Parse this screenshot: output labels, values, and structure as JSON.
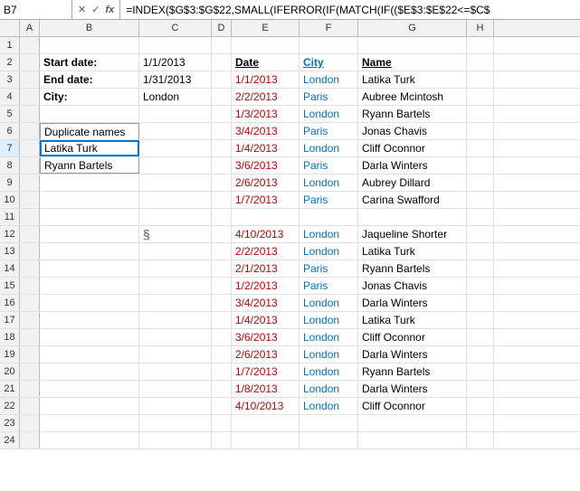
{
  "formula_bar": {
    "cell_ref": "B7",
    "formula": "=INDEX($G$3:$G$22,SMALL(IFERROR(IF(MATCH(IF(($E$3:$E$22<=$C$"
  },
  "columns": [
    "",
    "A",
    "B",
    "C",
    "D",
    "E",
    "F",
    "G",
    "H"
  ],
  "rows": [
    {
      "num": "1",
      "b": "",
      "c": "",
      "d": "",
      "e": "",
      "f": "",
      "g": "",
      "h": ""
    },
    {
      "num": "2",
      "b": "Start date:",
      "c": "1/1/2013",
      "d": "",
      "e": "Date",
      "f": "City",
      "g": "Name",
      "h": ""
    },
    {
      "num": "3",
      "b": "End date:",
      "c": "1/31/2013",
      "d": "",
      "e": "1/1/2013",
      "f": "London",
      "g": "Latika Turk",
      "h": ""
    },
    {
      "num": "4",
      "b": "City:",
      "c": "London",
      "d": "",
      "e": "2/2/2013",
      "f": "Paris",
      "g": "Aubree Mcintosh",
      "h": ""
    },
    {
      "num": "5",
      "b": "",
      "c": "",
      "d": "",
      "e": "1/3/2013",
      "f": "London",
      "g": "Ryann Bartels",
      "h": ""
    },
    {
      "num": "6",
      "b": "Duplicate names",
      "c": "",
      "d": "",
      "e": "3/4/2013",
      "f": "Paris",
      "g": "Jonas Chavis",
      "h": ""
    },
    {
      "num": "7",
      "b": "Latika Turk",
      "c": "",
      "d": "",
      "e": "1/4/2013",
      "f": "London",
      "g": "Cliff Oconnor",
      "h": ""
    },
    {
      "num": "8",
      "b": "Ryann Bartels",
      "c": "",
      "d": "",
      "e": "3/6/2013",
      "f": "Paris",
      "g": "Darla Winters",
      "h": ""
    },
    {
      "num": "9",
      "b": "",
      "c": "",
      "d": "",
      "e": "2/6/2013",
      "f": "London",
      "g": "Aubrey Dillard",
      "h": ""
    },
    {
      "num": "10",
      "b": "",
      "c": "",
      "d": "",
      "e": "1/7/2013",
      "f": "Paris",
      "g": "Carina Swafford",
      "h": ""
    },
    {
      "num": "11",
      "b": "",
      "c": "",
      "d": "",
      "e": "",
      "f": "",
      "g": "",
      "h": ""
    },
    {
      "num": "12",
      "b": "",
      "c": "§",
      "d": "",
      "e": "4/10/2013",
      "f": "London",
      "g": "Jaqueline Shorter",
      "h": ""
    },
    {
      "num": "13",
      "b": "",
      "c": "",
      "d": "",
      "e": "2/2/2013",
      "f": "London",
      "g": "Latika Turk",
      "h": ""
    },
    {
      "num": "14",
      "b": "",
      "c": "",
      "d": "",
      "e": "2/1/2013",
      "f": "Paris",
      "g": "Ryann Bartels",
      "h": ""
    },
    {
      "num": "15",
      "b": "",
      "c": "",
      "d": "",
      "e": "1/2/2013",
      "f": "Paris",
      "g": "Jonas Chavis",
      "h": ""
    },
    {
      "num": "16",
      "b": "",
      "c": "",
      "d": "",
      "e": "3/4/2013",
      "f": "London",
      "g": "Darla Winters",
      "h": ""
    },
    {
      "num": "17",
      "b": "",
      "c": "",
      "d": "",
      "e": "1/4/2013",
      "f": "London",
      "g": "Latika Turk",
      "h": ""
    },
    {
      "num": "18",
      "b": "",
      "c": "",
      "d": "",
      "e": "3/6/2013",
      "f": "London",
      "g": "Cliff Oconnor",
      "h": ""
    },
    {
      "num": "19",
      "b": "",
      "c": "",
      "d": "",
      "e": "2/6/2013",
      "f": "London",
      "g": "Darla Winters",
      "h": ""
    },
    {
      "num": "20",
      "b": "",
      "c": "",
      "d": "",
      "e": "1/7/2013",
      "f": "London",
      "g": "Ryann Bartels",
      "h": ""
    },
    {
      "num": "21",
      "b": "",
      "c": "",
      "d": "",
      "e": "1/8/2013",
      "f": "London",
      "g": "Darla Winters",
      "h": ""
    },
    {
      "num": "22",
      "b": "",
      "c": "",
      "d": "",
      "e": "4/10/2013",
      "f": "London",
      "g": "Cliff Oconnor",
      "h": ""
    },
    {
      "num": "23",
      "b": "",
      "c": "",
      "d": "",
      "e": "",
      "f": "",
      "g": "",
      "h": ""
    },
    {
      "num": "24",
      "b": "",
      "c": "",
      "d": "",
      "e": "",
      "f": "",
      "g": "",
      "h": ""
    }
  ],
  "labels": {
    "start_date": "Start date:",
    "end_date": "End date:",
    "city": "City:",
    "duplicate_names": "Duplicate names",
    "start_val": "1/1/2013",
    "end_val": "1/31/2013",
    "city_val": "London",
    "name1": "Latika Turk",
    "name2": "Ryann Bartels",
    "section_symbol": "§",
    "header_date": "Date",
    "header_city": "City",
    "header_name": "Name"
  }
}
